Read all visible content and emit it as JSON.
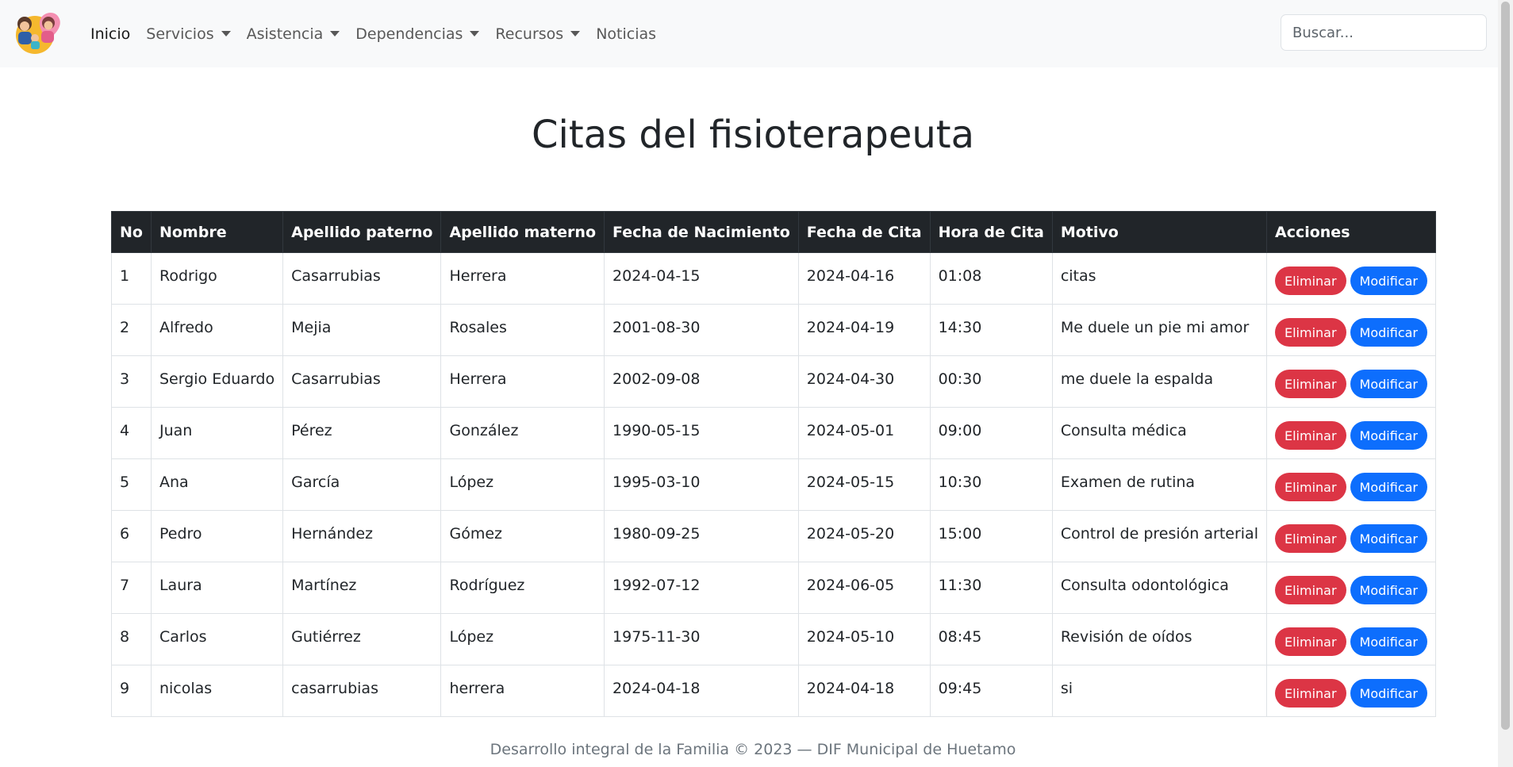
{
  "nav": {
    "items": [
      {
        "label": "Inicio",
        "dropdown": false,
        "active": true
      },
      {
        "label": "Servicios",
        "dropdown": true
      },
      {
        "label": "Asistencia",
        "dropdown": true
      },
      {
        "label": "Dependencias",
        "dropdown": true
      },
      {
        "label": "Recursos",
        "dropdown": true
      },
      {
        "label": "Noticias",
        "dropdown": false
      }
    ],
    "search_placeholder": "Buscar..."
  },
  "page": {
    "title": "Citas del fisioterapeuta"
  },
  "table": {
    "headers": [
      "No",
      "Nombre",
      "Apellido paterno",
      "Apellido materno",
      "Fecha de Nacimiento",
      "Fecha de Cita",
      "Hora de Cita",
      "Motivo",
      "Acciones"
    ],
    "delete_label": "Eliminar",
    "modify_label": "Modificar",
    "rows": [
      [
        "1",
        "Rodrigo",
        "Casarrubias",
        "Herrera",
        "2024-04-15",
        "2024-04-16",
        "01:08",
        "citas"
      ],
      [
        "2",
        "Alfredo",
        "Mejia",
        "Rosales",
        "2001-08-30",
        "2024-04-19",
        "14:30",
        "Me duele un pie mi amor"
      ],
      [
        "3",
        "Sergio Eduardo",
        "Casarrubias",
        "Herrera",
        "2002-09-08",
        "2024-04-30",
        "00:30",
        "me duele la espalda"
      ],
      [
        "4",
        "Juan",
        "Pérez",
        "González",
        "1990-05-15",
        "2024-05-01",
        "09:00",
        "Consulta médica"
      ],
      [
        "5",
        "Ana",
        "García",
        "López",
        "1995-03-10",
        "2024-05-15",
        "10:30",
        "Examen de rutina"
      ],
      [
        "6",
        "Pedro",
        "Hernández",
        "Gómez",
        "1980-09-25",
        "2024-05-20",
        "15:00",
        "Control de presión arterial"
      ],
      [
        "7",
        "Laura",
        "Martínez",
        "Rodríguez",
        "1992-07-12",
        "2024-06-05",
        "11:30",
        "Consulta odontológica"
      ],
      [
        "8",
        "Carlos",
        "Gutiérrez",
        "López",
        "1975-11-30",
        "2024-05-10",
        "08:45",
        "Revisión de oídos"
      ],
      [
        "9",
        "nicolas",
        "casarrubias",
        "herrera",
        "2024-04-18",
        "2024-04-18",
        "09:45",
        "si"
      ]
    ]
  },
  "footer": {
    "text": "Desarrollo integral de la Familia © 2023 — DIF Municipal de Huetamo"
  },
  "colors": {
    "danger": "#dc3545",
    "primary": "#0d6efd",
    "table_header": "#212529",
    "navbar": "#f8f9fa"
  },
  "icons": {
    "logo": "family-logo-icon",
    "dropdown": "caret-down-icon"
  }
}
